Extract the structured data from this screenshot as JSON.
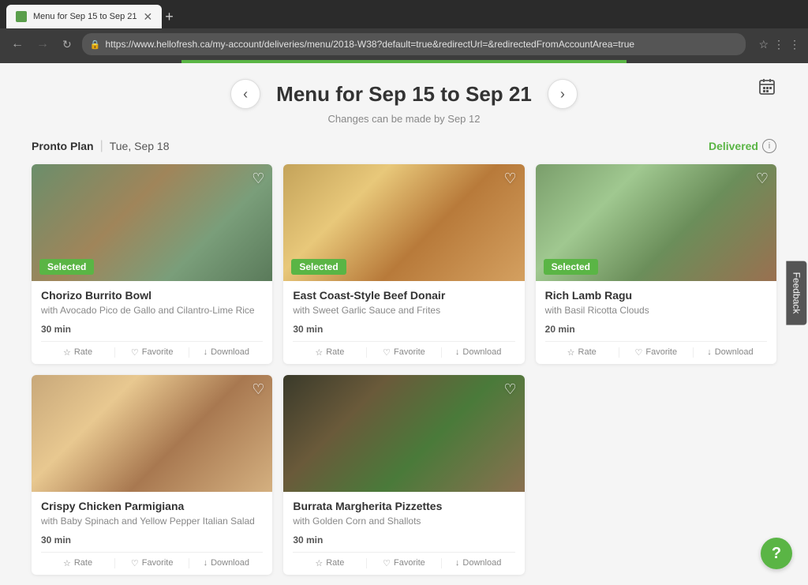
{
  "browser": {
    "tab_title": "Menu for Sep 15 to Sep 21",
    "url": "https://www.hellofresh.ca/my-account/deliveries/menu/2018-W38?default=true&redirectUrl=&redirectedFromAccountArea=true",
    "new_tab_label": "+",
    "back_disabled": false,
    "forward_disabled": true
  },
  "page": {
    "menu_title": "Menu for Sep 15 to Sep 21",
    "menu_subtitle": "Changes can be made by Sep 12",
    "plan_label": "Pronto Plan",
    "plan_date": "Tue, Sep 18",
    "delivered_label": "Delivered",
    "feedback_label": "Feedback"
  },
  "meals": [
    {
      "id": "chorizo",
      "name": "Chorizo Burrito Bowl",
      "desc": "with Avocado Pico de Gallo and Cilantro-Lime Rice",
      "time": "30 min",
      "selected": true,
      "img_class": "img-burrito"
    },
    {
      "id": "donair",
      "name": "East Coast-Style Beef Donair",
      "desc": "with Sweet Garlic Sauce and Frites",
      "time": "30 min",
      "selected": true,
      "img_class": "img-donair"
    },
    {
      "id": "lamb",
      "name": "Rich Lamb Ragu",
      "desc": "with Basil Ricotta Clouds",
      "time": "20 min",
      "selected": true,
      "img_class": "img-lamb"
    },
    {
      "id": "chicken",
      "name": "Crispy Chicken Parmigiana",
      "desc": "with Baby Spinach and Yellow Pepper Italian Salad",
      "time": "30 min",
      "selected": false,
      "img_class": "img-chicken"
    },
    {
      "id": "pizza",
      "name": "Burrata Margherita Pizzettes",
      "desc": "with Golden Corn and Shallots",
      "time": "30 min",
      "selected": false,
      "img_class": "img-pizza"
    }
  ],
  "actions": {
    "rate_label": "Rate",
    "favorite_label": "Favorite",
    "download_label": "Download",
    "selected_label": "Selected"
  }
}
